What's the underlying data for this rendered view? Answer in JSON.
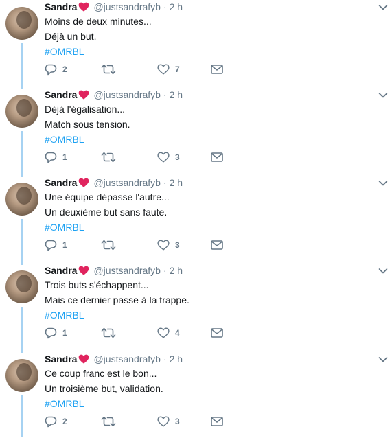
{
  "colors": {
    "accent": "#1da1f2",
    "secondary": "#657786",
    "thread": "#a6d2f2",
    "heart": "#e0245e"
  },
  "tweets": [
    {
      "name": "Sandra",
      "handle": "@justsandrafyb",
      "dot": "·",
      "time": "2 h",
      "line1": "Moins de deux minutes...",
      "line2": "Déjà un but.",
      "hashtag": "#OMRBL",
      "replies": "2",
      "retweets": "",
      "likes": "7"
    },
    {
      "name": "Sandra",
      "handle": "@justsandrafyb",
      "dot": "·",
      "time": "2 h",
      "line1": "Déjà l'égalisation...",
      "line2": "Match sous tension.",
      "hashtag": "#OMRBL",
      "replies": "1",
      "retweets": "",
      "likes": "3"
    },
    {
      "name": "Sandra",
      "handle": "@justsandrafyb",
      "dot": "·",
      "time": "2 h",
      "line1": "Une équipe dépasse l'autre...",
      "line2": "Un deuxième but sans faute.",
      "hashtag": "#OMRBL",
      "replies": "1",
      "retweets": "",
      "likes": "3"
    },
    {
      "name": "Sandra",
      "handle": "@justsandrafyb",
      "dot": "·",
      "time": "2 h",
      "line1": "Trois buts s'échappent...",
      "line2": "Mais ce dernier passe à la trappe.",
      "hashtag": "#OMRBL",
      "replies": "1",
      "retweets": "",
      "likes": "4"
    },
    {
      "name": "Sandra",
      "handle": "@justsandrafyb",
      "dot": "·",
      "time": "2 h",
      "line1": "Ce coup franc est le bon...",
      "line2": "Un troisième but, validation.",
      "hashtag": "#OMRBL",
      "replies": "2",
      "retweets": "",
      "likes": "3"
    }
  ]
}
